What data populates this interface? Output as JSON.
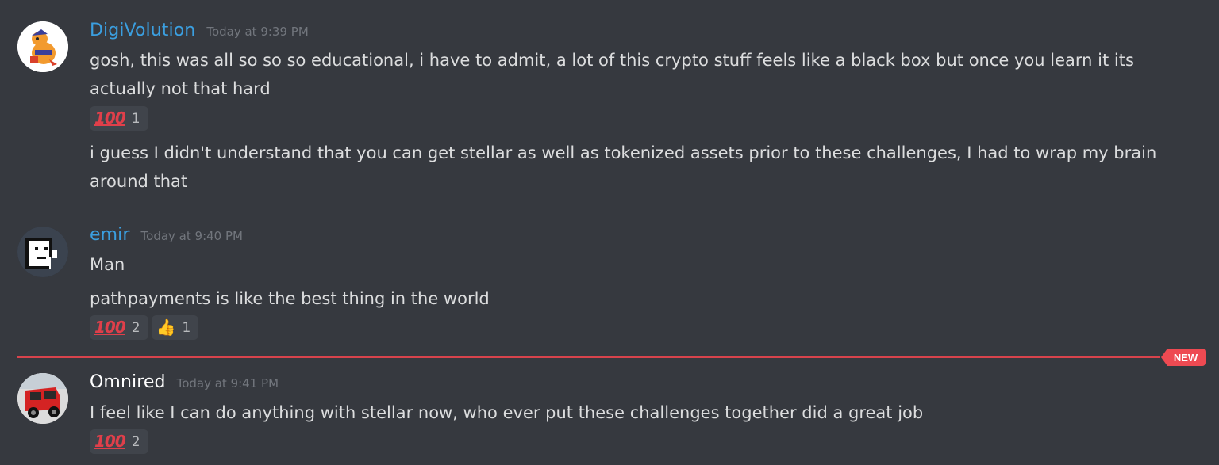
{
  "colors": {
    "background": "#36393f",
    "link_username": "#3b9fe0",
    "white_username": "#ffffff",
    "timestamp": "#72767d",
    "new_divider": "#d8434c"
  },
  "messages": [
    {
      "username": "DigiVolution",
      "username_color": "#3b9fe0",
      "timestamp": "Today at 9:39 PM",
      "avatar_icon": "orange-creature-avatar",
      "lines": [
        "gosh, this was all so so so educational, i have to admit, a lot of this crypto stuff feels like a black box but once you learn it its actually not that hard",
        "i guess I didn't understand that you can get stellar as well as tokenized assets prior to these challenges, I had to wrap my brain around that"
      ],
      "reactions": [
        {
          "emoji": "100-icon",
          "glyph": "100",
          "count": "1"
        }
      ]
    },
    {
      "username": "emir",
      "username_color": "#3b9fe0",
      "timestamp": "Today at 9:40 PM",
      "avatar_icon": "pixel-face-avatar",
      "lines": [
        "Man",
        "pathpayments is like the best thing in the world"
      ],
      "reactions": [
        {
          "emoji": "100-icon",
          "glyph": "100",
          "count": "2"
        },
        {
          "emoji": "thumbs-up-icon",
          "glyph": "👍",
          "count": "1"
        }
      ]
    },
    {
      "username": "Omnired",
      "username_color": "#ffffff",
      "timestamp": "Today at 9:41 PM",
      "avatar_icon": "red-car-avatar",
      "lines": [
        "I feel like I can do anything with stellar now, who ever put these challenges together did a great job"
      ],
      "reactions": [
        {
          "emoji": "100-icon",
          "glyph": "100",
          "count": "2"
        }
      ]
    }
  ],
  "new_divider": {
    "label": "NEW"
  }
}
